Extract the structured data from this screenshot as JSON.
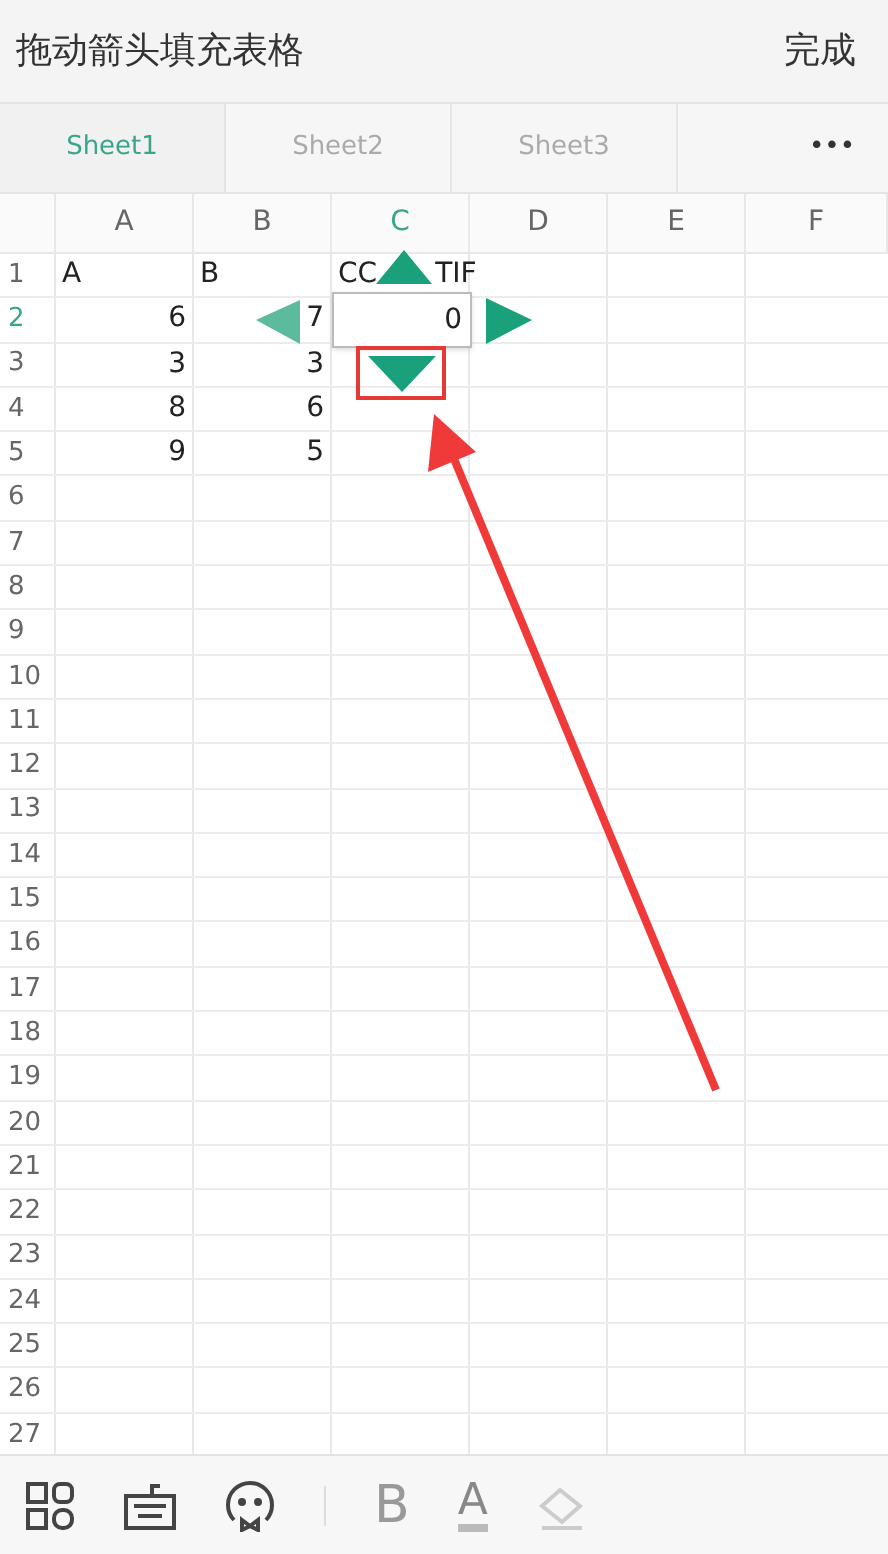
{
  "header": {
    "title": "拖动箭头填充表格",
    "done": "完成"
  },
  "tabs": [
    {
      "label": "Sheet1",
      "selected": true
    },
    {
      "label": "Sheet2",
      "selected": false
    },
    {
      "label": "Sheet3",
      "selected": false
    }
  ],
  "more": "•••",
  "columns": [
    {
      "label": "A",
      "selected": false
    },
    {
      "label": "B",
      "selected": false
    },
    {
      "label": "C",
      "selected": true
    },
    {
      "label": "D",
      "selected": false
    },
    {
      "label": "E",
      "selected": false
    },
    {
      "label": "F",
      "selected": false
    }
  ],
  "rows": [
    {
      "number": "1",
      "selected": false,
      "cells": [
        "A",
        "B",
        "CC",
        "",
        "",
        ""
      ]
    },
    {
      "number": "2",
      "selected": true,
      "cells": [
        "6",
        "7",
        "0",
        "",
        "",
        ""
      ]
    },
    {
      "number": "3",
      "selected": false,
      "cells": [
        "3",
        "3",
        "",
        "",
        "",
        ""
      ]
    },
    {
      "number": "4",
      "selected": false,
      "cells": [
        "8",
        "6",
        "",
        "",
        "",
        ""
      ]
    },
    {
      "number": "5",
      "selected": false,
      "cells": [
        "9",
        "5",
        "",
        "",
        "",
        ""
      ]
    },
    {
      "number": "6",
      "selected": false,
      "cells": []
    },
    {
      "number": "7",
      "selected": false,
      "cells": []
    },
    {
      "number": "8",
      "selected": false,
      "cells": []
    },
    {
      "number": "9",
      "selected": false,
      "cells": []
    },
    {
      "number": "10",
      "selected": false,
      "cells": []
    },
    {
      "number": "11",
      "selected": false,
      "cells": []
    },
    {
      "number": "12",
      "selected": false,
      "cells": []
    },
    {
      "number": "13",
      "selected": false,
      "cells": []
    },
    {
      "number": "14",
      "selected": false,
      "cells": []
    },
    {
      "number": "15",
      "selected": false,
      "cells": []
    },
    {
      "number": "16",
      "selected": false,
      "cells": []
    },
    {
      "number": "17",
      "selected": false,
      "cells": []
    },
    {
      "number": "18",
      "selected": false,
      "cells": []
    },
    {
      "number": "19",
      "selected": false,
      "cells": []
    },
    {
      "number": "20",
      "selected": false,
      "cells": []
    },
    {
      "number": "21",
      "selected": false,
      "cells": []
    },
    {
      "number": "22",
      "selected": false,
      "cells": []
    },
    {
      "number": "23",
      "selected": false,
      "cells": []
    },
    {
      "number": "24",
      "selected": false,
      "cells": []
    },
    {
      "number": "25",
      "selected": false,
      "cells": []
    },
    {
      "number": "26",
      "selected": false,
      "cells": []
    },
    {
      "number": "27",
      "selected": false,
      "cells": []
    }
  ],
  "cell_overflow": "TIF",
  "toolbar": [
    {
      "kind": "grid"
    },
    {
      "kind": "keyboard"
    },
    {
      "kind": "face"
    },
    {
      "kind": "divider"
    },
    {
      "kind": "bold",
      "label": "B"
    },
    {
      "kind": "color",
      "label": "A"
    },
    {
      "kind": "eraser"
    }
  ]
}
